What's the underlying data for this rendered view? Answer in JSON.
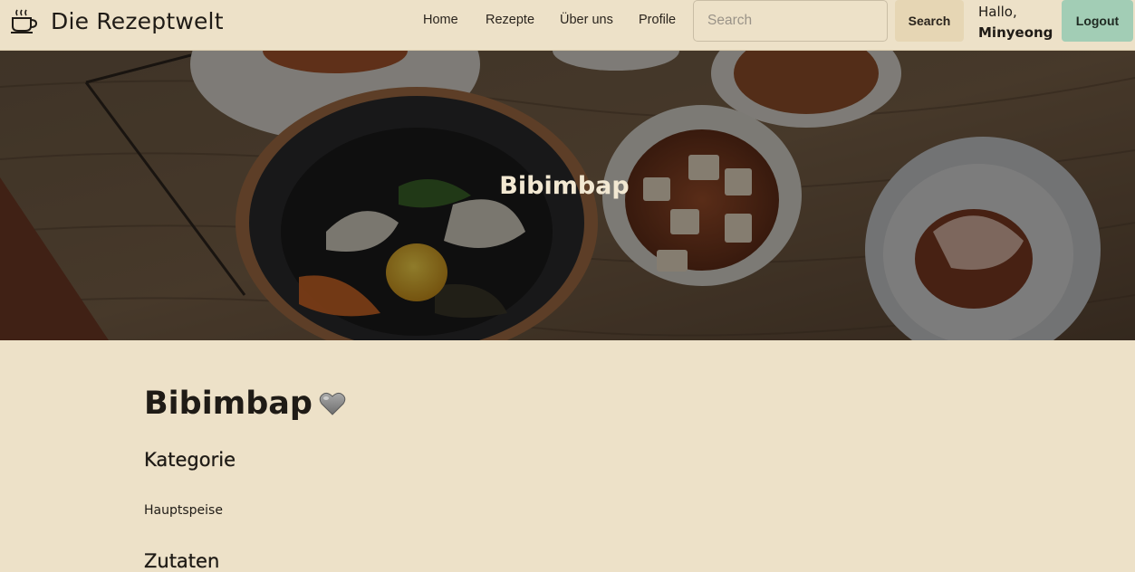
{
  "navbar": {
    "brand": "Die Rezeptwelt",
    "links": [
      "Home",
      "Rezepte",
      "Über uns",
      "Profile"
    ],
    "search_placeholder": "Search",
    "search_button": "Search",
    "greeting": "Hallo,",
    "username": "Minyeong",
    "logout_button": "Logout",
    "icons": {
      "brand": "coffee-cup-icon"
    }
  },
  "hero": {
    "title": "Bibimbap"
  },
  "recipe": {
    "title": "Bibimbap",
    "favorite_icon": "heart-icon",
    "sections": {
      "category_heading": "Kategorie",
      "category_value": "Hauptspeise",
      "ingredients_heading": "Zutaten"
    }
  },
  "colors": {
    "page_background": "#ede1c8",
    "logout_button": "#a2cdb5",
    "search_button": "#e6d6b4",
    "hero_text": "#f2e8d2"
  }
}
